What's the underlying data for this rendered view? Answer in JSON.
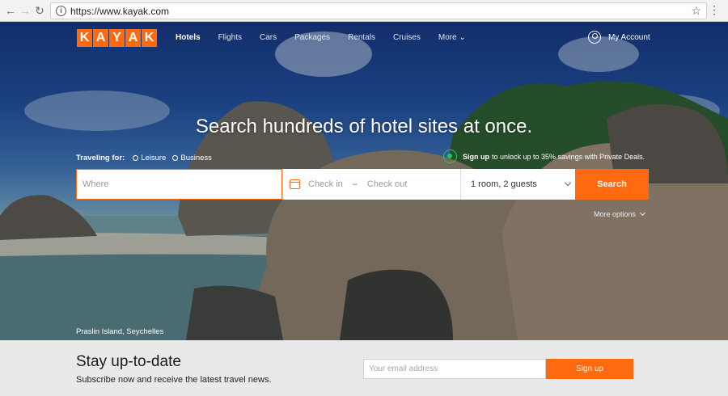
{
  "browser": {
    "url": "https://www.kayak.com",
    "info_icon": "i",
    "star_icon": "☆",
    "menu_icon": "⋮",
    "back_icon": "←",
    "forward_icon": "→",
    "reload_icon": "↻"
  },
  "brand": {
    "letters": [
      "K",
      "A",
      "Y",
      "A",
      "K"
    ],
    "accent_color": "#ff690f"
  },
  "nav": {
    "items": [
      "Hotels",
      "Flights",
      "Cars",
      "Packages",
      "Rentals",
      "Cruises",
      "More"
    ],
    "more_chevron": "⌄",
    "account_label": "My Account"
  },
  "hero": {
    "headline": "Search hundreds of hotel sites at once.",
    "traveling_for_label": "Traveling for:",
    "options": [
      "Leisure",
      "Business"
    ],
    "promo_strong": "Sign up",
    "promo_text": "to unlock up to 35% savings with Private Deals.",
    "where_placeholder": "Where",
    "check_in": "Check in",
    "dash": "–",
    "check_out": "Check out",
    "guests": "1 room, 2 guests",
    "search_label": "Search",
    "more_options": "More options",
    "caption": "Praslin Island, Seychelles"
  },
  "newsletter": {
    "title": "Stay up-to-date",
    "subtitle": "Subscribe now and receive the latest travel news.",
    "email_placeholder": "Your email address",
    "signup_label": "Sign up"
  }
}
